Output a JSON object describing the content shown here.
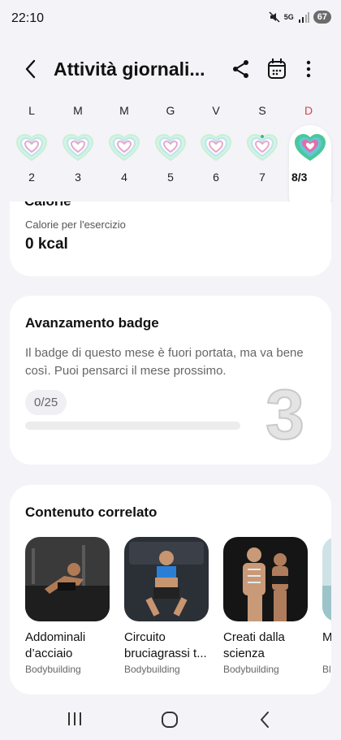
{
  "status": {
    "time": "22:10",
    "network": "5G",
    "battery": "67"
  },
  "header": {
    "title": "Attività giornali...",
    "icons": [
      "back-arrow-icon",
      "share-icon",
      "calendar-icon",
      "more-vert-icon"
    ]
  },
  "week": {
    "days": [
      {
        "letter": "L",
        "num": "2"
      },
      {
        "letter": "M",
        "num": "3"
      },
      {
        "letter": "M",
        "num": "4"
      },
      {
        "letter": "G",
        "num": "5"
      },
      {
        "letter": "V",
        "num": "6"
      },
      {
        "letter": "S",
        "num": "7"
      },
      {
        "letter": "D",
        "num": "8/3"
      }
    ]
  },
  "calorie_card": {
    "cut_title": "Calorie",
    "subtitle": "Calorie per l'esercizio",
    "value": "0 kcal"
  },
  "badge_card": {
    "title": "Avanzamento badge",
    "text": "Il badge di questo mese è fuori portata, ma va bene così. Puoi pensarci il mese prossimo.",
    "count": "0/25",
    "progress_fraction": 0,
    "badge_digit": "3"
  },
  "related_card": {
    "title": "Contenuto correlato",
    "items": [
      {
        "title": "Addominali d’acciaio",
        "category": "Bodybuilding"
      },
      {
        "title": "Circuito bruciagrassi t...",
        "category": "Bodybuilding"
      },
      {
        "title": "Creati dalla scienza",
        "category": "Bodybuilding"
      },
      {
        "title": "M de",
        "category": "Bl"
      }
    ]
  },
  "colors": {
    "sunday": "#d04848",
    "accent": "#6c63d9",
    "heart_inner": "#e8a7c9",
    "heart_mid": "#bfe6f0",
    "heart_outer": "#c6f0d6",
    "today_heart": "#4cc79a"
  }
}
